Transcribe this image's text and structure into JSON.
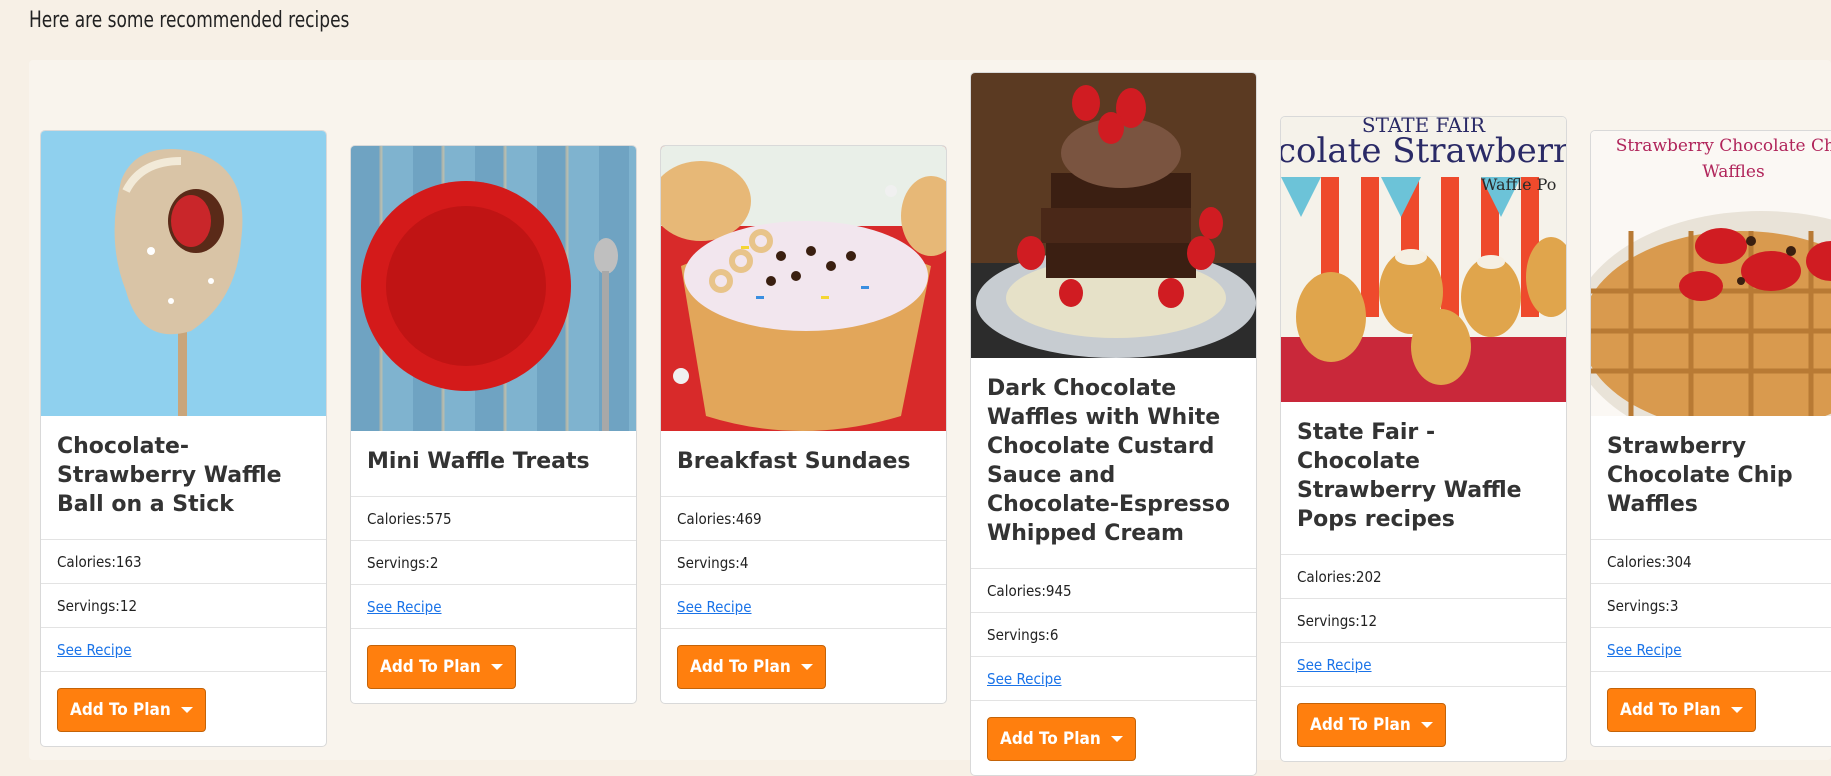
{
  "heading": "Here are some recommended recipes",
  "labels": {
    "calories": "Calories: ",
    "servings": "Servings: ",
    "see_recipe": "See Recipe",
    "add_to_plan": "Add To Plan"
  },
  "recipes": [
    {
      "title": "Chocolate-Strawberry Waffle Ball on a Stick",
      "calories": "163",
      "servings": "12"
    },
    {
      "title": "Mini Waffle Treats",
      "calories": "575",
      "servings": "2"
    },
    {
      "title": "Breakfast Sundaes",
      "calories": "469",
      "servings": "4"
    },
    {
      "title": "Dark Chocolate Waffles with White Chocolate Custard Sauce and Chocolate-Espresso Whipped Cream",
      "calories": "945",
      "servings": "6"
    },
    {
      "title": "State Fair - Chocolate Strawberry Waffle Pops recipes",
      "calories": "202",
      "servings": "12"
    },
    {
      "title": "Strawberry Chocolate Chip Waffles",
      "calories": "304",
      "servings": "3",
      "image_text": "Strawberry Chocolate Chip Waffles"
    }
  ],
  "image_text": {
    "state_fair_1": "STATE FAIR",
    "state_fair_2": "colate Strawberr",
    "state_fair_3": "Waffle Po"
  },
  "colors": {
    "accent": "#ff7f0e",
    "link": "#1a73e8",
    "background": "#f7f0e6"
  }
}
